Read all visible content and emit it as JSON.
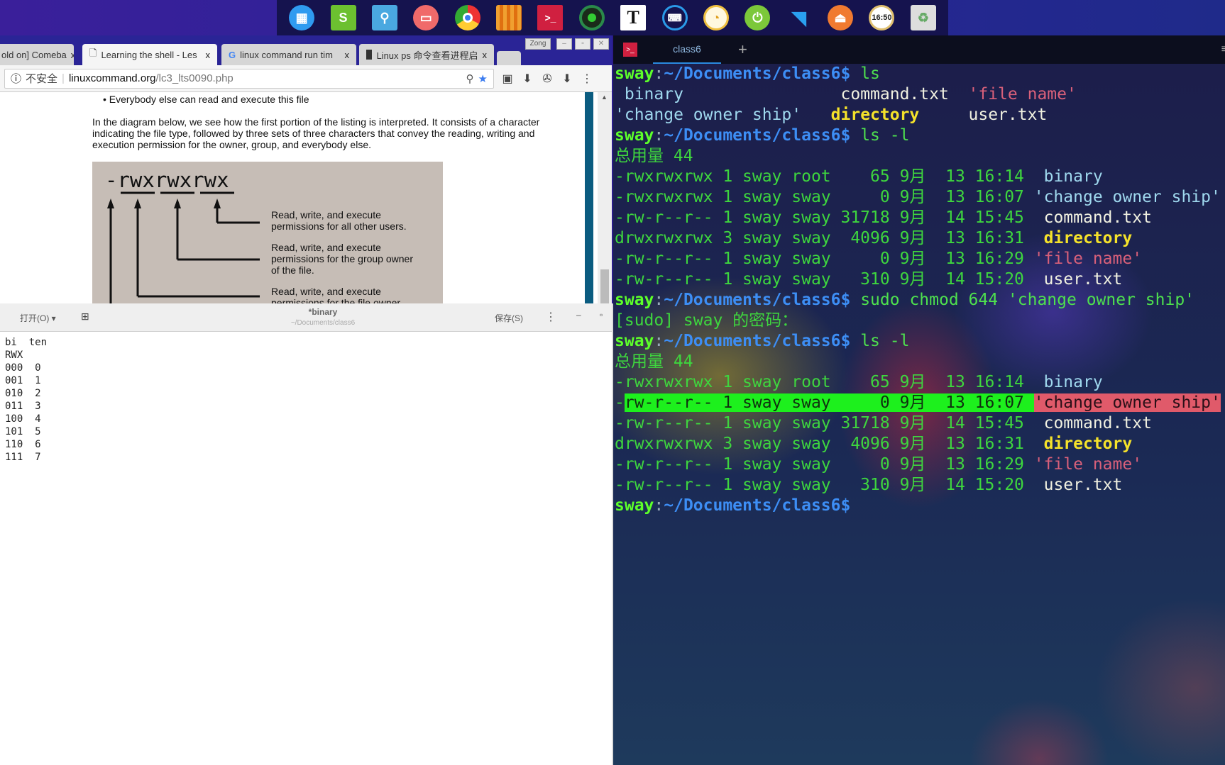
{
  "dock": {
    "icons": [
      "launcher-icon",
      "spreadsheet-icon",
      "file-manager-icon",
      "screenshot-icon",
      "chrome-icon",
      "app-store-icon",
      "terminal-icon",
      "camera-icon",
      "text-editor-icon",
      "keyboard-icon",
      "music-icon",
      "power-icon",
      "wifi-icon",
      "eject-icon",
      "clock-icon",
      "trash-icon"
    ],
    "clock_text": "16:50",
    "text_icon_glyph": "T"
  },
  "browser": {
    "tabs": [
      {
        "label": "old on] Comeba"
      },
      {
        "label": "Learning the shell - Les"
      },
      {
        "label": "linux command run tim"
      },
      {
        "label": "Linux ps 命令查看进程启"
      }
    ],
    "profile": "Zong",
    "security": "不安全",
    "url_host": "linuxcommand.org",
    "url_path": "/lc3_lts0090.php",
    "page": {
      "bullet": "Everybody else can read and execute this file",
      "paragraph": "In the diagram below, we see how the first portion of the listing is interpreted. It consists of a character indicating the file type, followed by three sets of three characters that convey the reading, writing and execution permission for the owner, group, and everybody else.",
      "diagram": {
        "perm": "-rwxrwxrwx",
        "labels": [
          "Read, write, and execute",
          "permissions for all other users.",
          "Read, write, and execute",
          "permissions for the group owner",
          "of the file.",
          "Read, write, and execute",
          "permissions for the file owner"
        ]
      }
    }
  },
  "editor": {
    "open_label": "打开(O)",
    "title": "*binary",
    "subtitle": "~/Documents/class6",
    "save_label": "保存(S)",
    "content": "bi  ten\nRWX\n000  0\n001  1\n010  2\n011  3\n100  4\n101  5\n110  6\n111  7"
  },
  "terminal": {
    "tab_label": "class6",
    "lines": [
      [
        [
          "sway",
          "user"
        ],
        [
          ":",
          "colon"
        ],
        [
          "~/Documents/class6$",
          "path"
        ],
        [
          " ls",
          "cmd"
        ]
      ],
      [
        [
          " binary",
          "exec"
        ],
        [
          "                command.txt  ",
          "file"
        ],
        [
          "'file name'",
          "quote"
        ]
      ],
      [
        [
          "'change owner ship'",
          "exec"
        ],
        [
          "   ",
          "file"
        ],
        [
          "directory",
          "dir"
        ],
        [
          "     user.txt",
          "file"
        ]
      ],
      [
        [
          "sway",
          "user"
        ],
        [
          ":",
          "colon"
        ],
        [
          "~/Documents/class6$",
          "path"
        ],
        [
          " ls -l",
          "cmd"
        ]
      ],
      [
        [
          "总用量 44",
          "out"
        ]
      ],
      [
        [
          "-rwxrwxrwx 1 sway root    65 9月  13 16:14  ",
          "out"
        ],
        [
          "binary",
          "exec"
        ]
      ],
      [
        [
          "-rwxrwxrwx 1 sway sway     0 9月  13 16:07 ",
          "out"
        ],
        [
          "'change owner ship'",
          "exec"
        ]
      ],
      [
        [
          "-rw-r--r-- 1 sway sway 31718 9月  14 15:45  ",
          "out"
        ],
        [
          "command.txt",
          "file"
        ]
      ],
      [
        [
          "drwxrwxrwx 3 sway sway  4096 9月  13 16:31  ",
          "out"
        ],
        [
          "directory",
          "dir"
        ]
      ],
      [
        [
          "-rw-r--r-- 1 sway sway     0 9月  13 16:29 ",
          "out"
        ],
        [
          "'file name'",
          "quote"
        ]
      ],
      [
        [
          "-rw-r--r-- 1 sway sway   310 9月  14 15:20  ",
          "out"
        ],
        [
          "user.txt",
          "file"
        ]
      ],
      [
        [
          "sway",
          "user"
        ],
        [
          ":",
          "colon"
        ],
        [
          "~/Documents/class6$",
          "path"
        ],
        [
          " sudo chmod 644 'change owner ship'",
          "cmd"
        ]
      ],
      [
        [
          "[sudo] sway 的密码：",
          "out"
        ]
      ],
      [
        [
          "sway",
          "user"
        ],
        [
          ":",
          "colon"
        ],
        [
          "~/Documents/class6$",
          "path"
        ],
        [
          " ls -l",
          "cmd"
        ]
      ],
      [
        [
          "总用量 44",
          "out"
        ]
      ],
      [
        [
          "-rwxrwxrwx 1 sway root    65 9月  13 16:14  ",
          "out"
        ],
        [
          "binary",
          "exec"
        ]
      ],
      [
        [
          "-",
          "out"
        ],
        [
          "rw-r--r-- 1 sway sway     0 9月  13 16:07 ",
          "hlgreen"
        ],
        [
          "'change owner ship'",
          "hlred"
        ]
      ],
      [
        [
          "-rw-r--r-- 1 sway sway 31718 9月  14 15:45  ",
          "out"
        ],
        [
          "command.txt",
          "file"
        ]
      ],
      [
        [
          "drwxrwxrwx 3 sway sway  4096 9月  13 16:31  ",
          "out"
        ],
        [
          "directory",
          "dir"
        ]
      ],
      [
        [
          "-rw-r--r-- 1 sway sway     0 9月  13 16:29 ",
          "out"
        ],
        [
          "'file name'",
          "quote"
        ]
      ],
      [
        [
          "-rw-r--r-- 1 sway sway   310 9月  14 15:20  ",
          "out"
        ],
        [
          "user.txt",
          "file"
        ]
      ],
      [
        [
          "sway",
          "user"
        ],
        [
          ":",
          "colon"
        ],
        [
          "~/Documents/class6$",
          "path"
        ]
      ]
    ]
  }
}
